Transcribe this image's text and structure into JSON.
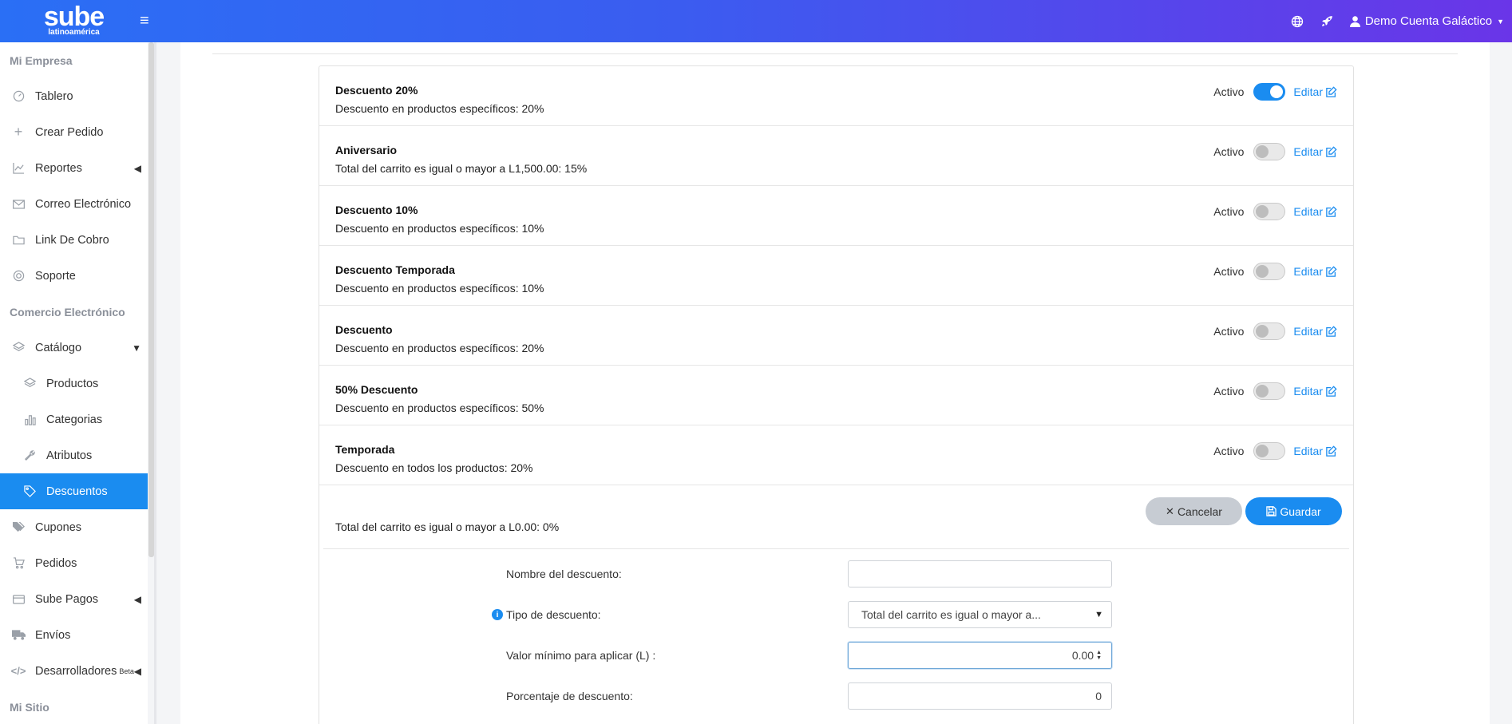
{
  "header": {
    "brand_main": "sube",
    "brand_sub": "latinoamérica",
    "user_name": "Demo Cuenta Galáctico"
  },
  "sidebar": {
    "sections": [
      {
        "title": "Mi Empresa"
      },
      {
        "title": "Comercio Electrónico"
      },
      {
        "title": "Mi Sitio"
      }
    ],
    "items": [
      {
        "label": "Tablero"
      },
      {
        "label": "Crear Pedido"
      },
      {
        "label": "Reportes"
      },
      {
        "label": "Correo Electrónico"
      },
      {
        "label": "Link De Cobro"
      },
      {
        "label": "Soporte"
      },
      {
        "label": "Catálogo"
      },
      {
        "label": "Productos"
      },
      {
        "label": "Categorias"
      },
      {
        "label": "Atributos"
      },
      {
        "label": "Descuentos"
      },
      {
        "label": "Cupones"
      },
      {
        "label": "Pedidos"
      },
      {
        "label": "Sube Pagos"
      },
      {
        "label": "Envíos"
      },
      {
        "label": "Desarrolladores",
        "badge": "Beta"
      }
    ]
  },
  "discounts": [
    {
      "title": "Descuento 20%",
      "desc": "Descuento en productos específicos: 20%",
      "active": true
    },
    {
      "title": "Aniversario",
      "desc": "Total del carrito es igual o mayor a L1,500.00: 15%",
      "active": false
    },
    {
      "title": "Descuento 10%",
      "desc": "Descuento en productos específicos: 10%",
      "active": false
    },
    {
      "title": "Descuento Temporada",
      "desc": "Descuento en productos específicos: 10%",
      "active": false
    },
    {
      "title": "Descuento",
      "desc": "Descuento en productos específicos: 20%",
      "active": false
    },
    {
      "title": "50% Descuento",
      "desc": "Descuento en productos específicos: 50%",
      "active": false
    },
    {
      "title": "Temporada",
      "desc": "Descuento en todos los productos: 20%",
      "active": false
    }
  ],
  "row_labels": {
    "status": "Activo",
    "edit": "Editar"
  },
  "form": {
    "summary": "Total del carrito es igual o mayor a L0.00: 0%",
    "cancel_label": "Cancelar",
    "save_label": "Guardar",
    "name_label": "Nombre del descuento:",
    "name_value": "",
    "type_label": "Tipo de descuento:",
    "type_value": "Total del carrito es igual o mayor a...",
    "min_label": "Valor mínimo para aplicar (L) :",
    "min_value": "0.00",
    "percent_label": "Porcentaje de descuento:",
    "percent_value": "0"
  },
  "colors": {
    "accent": "#1a8cf0",
    "header_start": "#2a6ff5",
    "header_end": "#6a35e8"
  }
}
